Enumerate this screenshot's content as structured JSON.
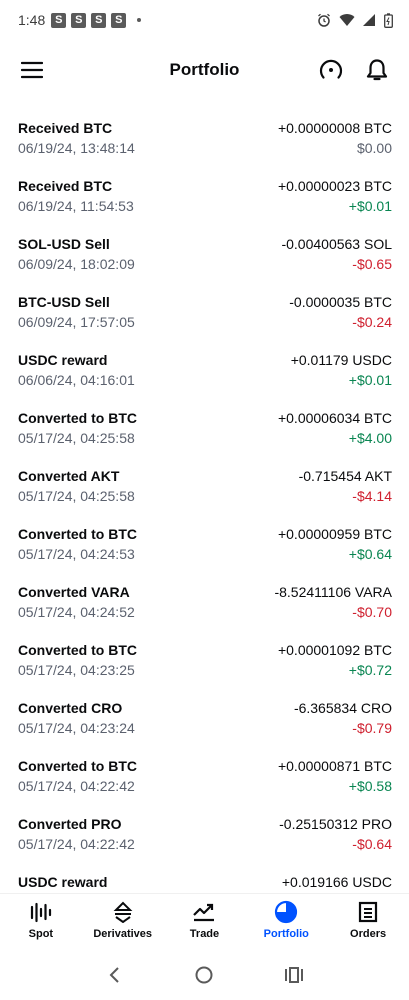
{
  "status_bar": {
    "time": "1:48",
    "notifications": [
      "S",
      "S",
      "S",
      "S"
    ]
  },
  "header": {
    "title": "Portfolio",
    "icons": [
      "menu-icon",
      "gauge-icon",
      "bell-icon"
    ]
  },
  "transactions": [
    {
      "title": "Received BTC",
      "date": "06/19/24, 13:48:14",
      "amount": "+0.00000008 BTC",
      "value": "$0.00",
      "tone": "neutral"
    },
    {
      "title": "Received BTC",
      "date": "06/19/24, 11:54:53",
      "amount": "+0.00000023 BTC",
      "value": "+$0.01",
      "tone": "pos"
    },
    {
      "title": "SOL-USD Sell",
      "date": "06/09/24, 18:02:09",
      "amount": "-0.00400563 SOL",
      "value": "-$0.65",
      "tone": "neg"
    },
    {
      "title": "BTC-USD Sell",
      "date": "06/09/24, 17:57:05",
      "amount": "-0.0000035 BTC",
      "value": "-$0.24",
      "tone": "neg"
    },
    {
      "title": "USDC reward",
      "date": "06/06/24, 04:16:01",
      "amount": "+0.01179 USDC",
      "value": "+$0.01",
      "tone": "pos"
    },
    {
      "title": "Converted to BTC",
      "date": "05/17/24, 04:25:58",
      "amount": "+0.00006034 BTC",
      "value": "+$4.00",
      "tone": "pos"
    },
    {
      "title": "Converted AKT",
      "date": "05/17/24, 04:25:58",
      "amount": "-0.715454 AKT",
      "value": "-$4.14",
      "tone": "neg"
    },
    {
      "title": "Converted to BTC",
      "date": "05/17/24, 04:24:53",
      "amount": "+0.00000959 BTC",
      "value": "+$0.64",
      "tone": "pos"
    },
    {
      "title": "Converted VARA",
      "date": "05/17/24, 04:24:52",
      "amount": "-8.52411106 VARA",
      "value": "-$0.70",
      "tone": "neg"
    },
    {
      "title": "Converted to BTC",
      "date": "05/17/24, 04:23:25",
      "amount": "+0.00001092 BTC",
      "value": "+$0.72",
      "tone": "pos"
    },
    {
      "title": "Converted CRO",
      "date": "05/17/24, 04:23:24",
      "amount": "-6.365834 CRO",
      "value": "-$0.79",
      "tone": "neg"
    },
    {
      "title": "Converted to BTC",
      "date": "05/17/24, 04:22:42",
      "amount": "+0.00000871 BTC",
      "value": "+$0.58",
      "tone": "pos"
    },
    {
      "title": "Converted PRO",
      "date": "05/17/24, 04:22:42",
      "amount": "-0.25150312 PRO",
      "value": "-$0.64",
      "tone": "neg"
    },
    {
      "title": "USDC reward",
      "date": "",
      "amount": "+0.019166 USDC",
      "value": "",
      "tone": "pos"
    }
  ],
  "bottom_nav": [
    {
      "label": "Spot",
      "icon": "spot-chart-icon",
      "active": false
    },
    {
      "label": "Derivatives",
      "icon": "derivatives-icon",
      "active": false
    },
    {
      "label": "Trade",
      "icon": "trade-icon",
      "active": false
    },
    {
      "label": "Portfolio",
      "icon": "pie-chart-icon",
      "active": true
    },
    {
      "label": "Orders",
      "icon": "orders-icon",
      "active": false
    }
  ],
  "colors": {
    "accent": "#0052ff",
    "positive": "#098551",
    "negative": "#cf202f",
    "muted": "#5b616e"
  }
}
